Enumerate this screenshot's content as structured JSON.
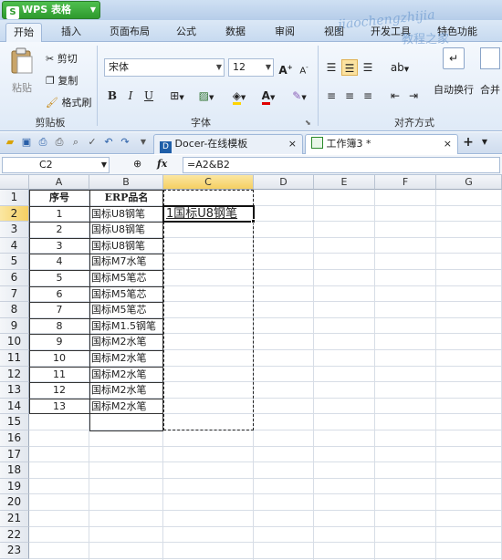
{
  "app": {
    "title": "WPS 表格",
    "icon": "S"
  },
  "menu": {
    "tabs": [
      "开始",
      "插入",
      "页面布局",
      "公式",
      "数据",
      "审阅",
      "视图",
      "开发工具",
      "特色功能"
    ],
    "active_index": 0
  },
  "ribbon": {
    "clipboard": {
      "paste_label": "粘贴",
      "cut_label": "剪切",
      "copy_label": "复制",
      "format_painter_label": "格式刷",
      "group_label": "剪贴板"
    },
    "font": {
      "font_name": "宋体",
      "font_size": "12",
      "bold": "B",
      "italic": "I",
      "underline": "U",
      "grow": "A",
      "shrink": "A",
      "group_label": "字体"
    },
    "alignment": {
      "wrap_label": "自动换行",
      "merge_label": "合并",
      "group_label": "对齐方式"
    }
  },
  "tabs": {
    "docer_label": "Docer-在线模板",
    "workbook_label": "工作簿3 *",
    "close_glyph": "×",
    "add_glyph": "+"
  },
  "formula_bar": {
    "name_box": "C2",
    "fx": "fx",
    "formula": "=A2&B2"
  },
  "columns": [
    "A",
    "B",
    "C",
    "D",
    "E",
    "F",
    "G"
  ],
  "rows": [
    "1",
    "2",
    "3",
    "4",
    "5",
    "6",
    "7",
    "8",
    "9",
    "10",
    "11",
    "12",
    "13",
    "14",
    "15",
    "16",
    "17",
    "18",
    "19",
    "20",
    "21",
    "22",
    "23"
  ],
  "headers": {
    "a": "序号",
    "b": "ERP品名"
  },
  "table": [
    {
      "a": "1",
      "b": "国标U8钢笔"
    },
    {
      "a": "2",
      "b": "国标U8钢笔"
    },
    {
      "a": "3",
      "b": "国标U8钢笔"
    },
    {
      "a": "4",
      "b": "国标M7水笔"
    },
    {
      "a": "5",
      "b": "国标M5笔芯"
    },
    {
      "a": "6",
      "b": "国标M5笔芯"
    },
    {
      "a": "7",
      "b": "国标M5笔芯"
    },
    {
      "a": "8",
      "b": "国标M1.5钢笔"
    },
    {
      "a": "9",
      "b": "国标M2水笔"
    },
    {
      "a": "10",
      "b": "国标M2水笔"
    },
    {
      "a": "11",
      "b": "国标M2水笔"
    },
    {
      "a": "12",
      "b": "国标M2水笔"
    },
    {
      "a": "13",
      "b": "国标M2水笔"
    }
  ],
  "c2_value": "1国标U8钢笔",
  "selected": {
    "col": "C",
    "row": "2"
  },
  "watermark": {
    "line1": "jiaochengzhijia",
    "line2": "教程之家"
  }
}
